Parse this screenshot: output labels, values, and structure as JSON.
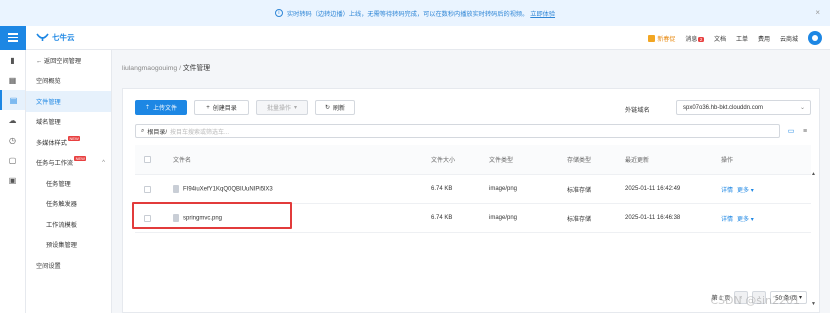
{
  "banner": {
    "text": "实时转码（边转边播）上线，无需等待转码完成，可以在数秒内播放实时转码后的视频。",
    "link": "立即体验",
    "close": "×"
  },
  "topbar": {
    "logo_text": "七牛云",
    "promo": "新春促",
    "messages": "消息",
    "messages_badge": "2",
    "docs": "文档",
    "tickets": "工单",
    "billing": "费用",
    "mall": "云商城"
  },
  "sidebar": {
    "back": "← 返回空间管理",
    "items": [
      {
        "label": "空间概览"
      },
      {
        "label": "文件管理"
      },
      {
        "label": "域名管理"
      },
      {
        "label": "多媒体样式",
        "badge": "NEW"
      },
      {
        "label": "任务与工作流",
        "badge": "NEW"
      },
      {
        "label": "任务管理"
      },
      {
        "label": "任务触发器"
      },
      {
        "label": "工作流模板"
      },
      {
        "label": "预设集管理"
      },
      {
        "label": "空间设置"
      }
    ]
  },
  "breadcrumb": {
    "bucket": "liulangmaogouimg",
    "sep": "/",
    "current": "文件管理"
  },
  "toolbar": {
    "upload": "上传文件",
    "new_dir": "创建目录",
    "batch": "批量操作",
    "refresh": "刷新",
    "domain_label": "外链域名",
    "domain_value": "spx07o36.hb-bkt.clouddn.com"
  },
  "search": {
    "prefix": "根目录/",
    "placeholder": "按目车搜索或筛选车..."
  },
  "table": {
    "headers": [
      "文件名",
      "文件大小",
      "文件类型",
      "存储类型",
      "最近更新",
      "操作"
    ],
    "rows": [
      {
        "name": "FI94iuXefY1KqQ0QBIUuNIPi5lX3",
        "size": "6.74 KB",
        "type": "image/png",
        "storage": "标准存储",
        "updated": "2025-01-11 16:42:49",
        "detail": "详情",
        "more": "更多"
      },
      {
        "name": "springmvc.png",
        "size": "6.74 KB",
        "type": "image/png",
        "storage": "标准存储",
        "updated": "2025-01-11 16:46:38",
        "detail": "详情",
        "more": "更多"
      }
    ]
  },
  "pager": {
    "page": "第 1 页",
    "size": "50 条/页"
  },
  "watermark": "CSDN @sin2201",
  "colors": {
    "accent": "#1d87e4",
    "highlight": "#e23b3b",
    "banner_bg": "#eaf4ff"
  }
}
